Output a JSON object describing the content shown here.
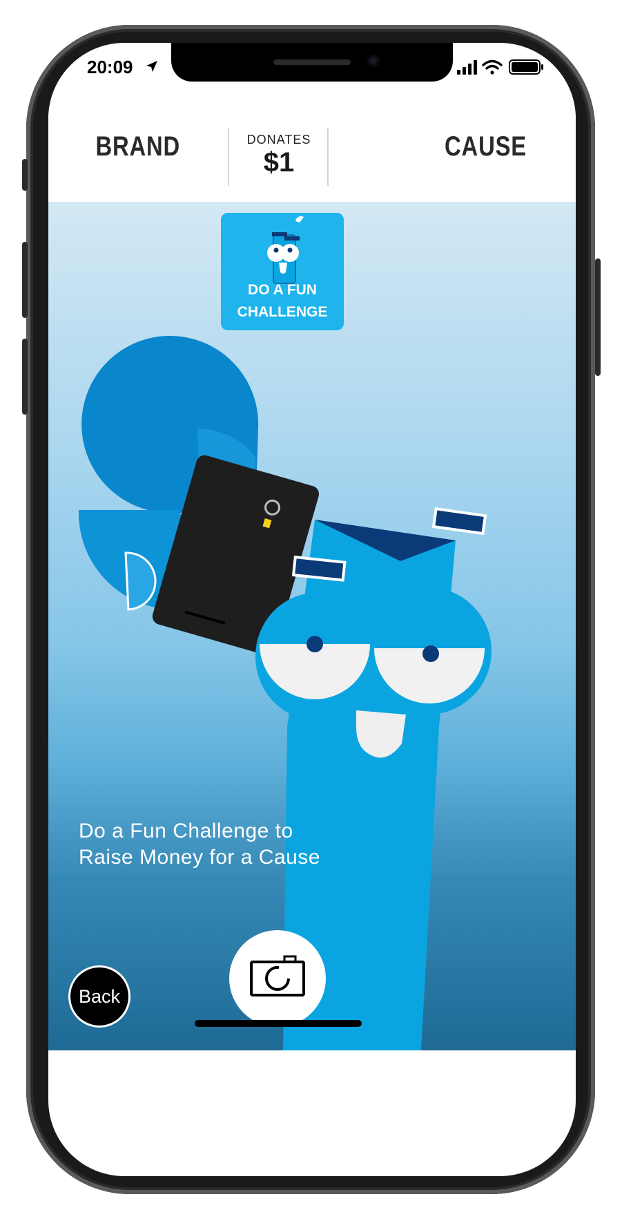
{
  "status_bar": {
    "time": "20:09",
    "icons": [
      "location-arrow-icon",
      "signal-icon",
      "wifi-icon",
      "battery-icon"
    ]
  },
  "header": {
    "brand": "BRAND",
    "donates": "DONATES",
    "amount": "$1",
    "cause": "CAUSE"
  },
  "challenge_card": {
    "line1": "DO A FUN",
    "line2": "CHALLENGE"
  },
  "tagline": {
    "line1": "Do a Fun Challenge to",
    "line2": "Raise Money for a Cause"
  },
  "buttons": {
    "back": "Back",
    "capture_icon": "camera-icon"
  },
  "colors": {
    "badge_blue": "#1fb4ec",
    "character_blue": "#0aa5e1",
    "dollar_blue": "#0a86cc",
    "navy": "#0b3a78"
  }
}
